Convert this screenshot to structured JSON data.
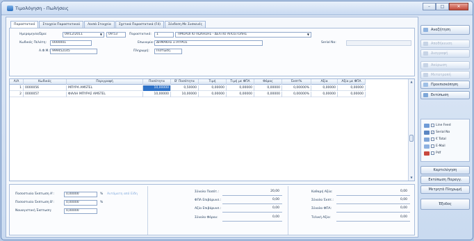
{
  "window": {
    "title": "Τιμολόγηση - Πωλήσεις",
    "controls": [
      "–",
      "□",
      "✕"
    ]
  },
  "tabs": [
    {
      "label": "Παραστατικό",
      "active": true
    },
    {
      "label": "Στοιχεία Παραστατικού",
      "active": false
    },
    {
      "label": "Λοιπά Στοιχεία",
      "active": false
    },
    {
      "label": "Σχετικά Παραστατικά (F4)",
      "active": false
    },
    {
      "label": "Σύνδεση Με Συσκευές",
      "active": false
    }
  ],
  "header": {
    "date_label": "Ημερομηνία/Ώρα:",
    "date_value": "09/12/2011",
    "time_value": "09:53",
    "doc_label": "Παραστατικό:",
    "doc_number": "1",
    "doc_type": "ΤΙΜΟΛΟΓΙΟ ΠΩΛΗΣΗΣ - ΔΕΛΤΙΟ ΑΠΟΣΤΟΛΗΣ",
    "customer_code_label": "Κωδικός Πελάτη:",
    "customer_code": "0000001",
    "name_label": "Επωνυμία:",
    "name_value": "ΔΗΜΑΚΗΣ ΣΤΑΥΡΟΣ",
    "serial_label": "Serial No:",
    "serial_value": "",
    "afm_label": "Α.Φ.Μ.:",
    "afm_value": "999452145",
    "payment_label": "Πληρωμή:",
    "payment_value": "Πίστωση"
  },
  "grid": {
    "columns": [
      "Α/Α",
      "Κωδικός",
      "Περιγραφή",
      "Ποσότητα",
      "Β' Ποσότητα",
      "Τιμή",
      "Τιμή με ΦΠΑ",
      "Φόρος",
      "Έκπτ%",
      "Αξία",
      "Αξία με ΦΠΑ"
    ],
    "rows": [
      [
        "1",
        "0000056",
        "ΜΠΥΡΑ AMSTEL",
        "10,00000",
        "0,50000",
        "0,00000",
        "0,00000",
        "0,00000",
        "0,00000%",
        "0,00000",
        "0,00000"
      ],
      [
        "2",
        "0000057",
        "ΦΙΑΛΗ ΜΠΥΡΑΣ AMSTEL",
        "10,00000",
        "10,00000",
        "0,00000",
        "0,00000",
        "0,00000",
        "0,00000%",
        "0,00000",
        "0,00000"
      ]
    ]
  },
  "discounts": {
    "a_label": "Ποσοστιαία Έκπτωση Α':",
    "a_value": "0,00000",
    "a_unit": "%",
    "a_link": "Αυτόματη από Είδη",
    "b_label": "Ποσοστιαία Έκπτωση Β':",
    "b_value": "0,00000",
    "b_unit": "%",
    "amount_label": "Ναυαγιστική Έκπτωση:",
    "amount_value": "0,00000"
  },
  "totals_mid": [
    {
      "label": "Σύνολο Ποσότ.:",
      "value": "20,00"
    },
    {
      "label": "ΦΠΑ Επιβάρυνσ.:",
      "value": "0,00"
    },
    {
      "label": "Αξία Επιβάρυνσ.:",
      "value": "0,00"
    },
    {
      "label": "Σύνολο Φόρου:",
      "value": "0,00"
    }
  ],
  "totals_right": [
    {
      "label": "Καθαρή Αξία:",
      "value": "0,00"
    },
    {
      "label": "Σύνολο Έκπτ.:",
      "value": "0,00"
    },
    {
      "label": "Σύνολο ΦΠΑ:",
      "value": "0,00"
    },
    {
      "label": "Τελική Αξία:",
      "value": "0,00"
    }
  ],
  "sidebar": {
    "search": "Αναζήτηση",
    "record": "Αποθήκευση",
    "delete": "Διαγραφή",
    "cancel": "Ακύρωση",
    "convert": "Μετατροπή",
    "preview": "Προεπισκόπηση",
    "print": "Εκτύπωση",
    "options": [
      {
        "label": "Line Feed",
        "checked": false
      },
      {
        "label": "Serial No",
        "checked": true
      },
      {
        "label": "€ Total",
        "checked": false
      },
      {
        "label": "E-Mail",
        "checked": false
      },
      {
        "label": "Pdf",
        "checked": false
      }
    ],
    "btn_ledger": "Καρτελόγηση",
    "btn_export": "Εκτύπωση Παραγγ.",
    "btn_paid": "Μετρητά Πληρωμή",
    "btn_exit": "Έξοδος"
  }
}
